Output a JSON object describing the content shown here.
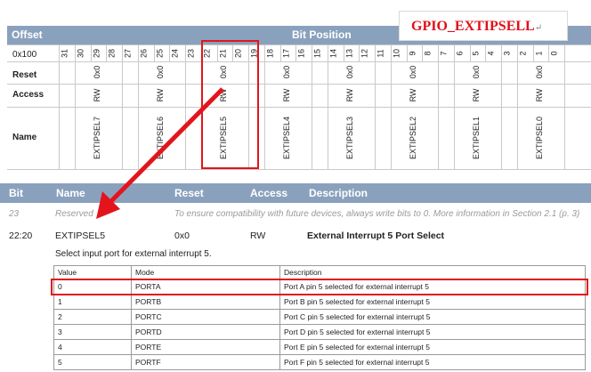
{
  "badge": {
    "title": "GPIO_EXTIPSELL",
    "mark": "↵"
  },
  "register": {
    "headers": {
      "offset": "Offset",
      "bit_position": "Bit Position"
    },
    "offset_value": "0x100",
    "row_labels": {
      "reset": "Reset",
      "access": "Access",
      "name": "Name"
    },
    "bits": [
      "31",
      "30",
      "29",
      "28",
      "27",
      "26",
      "25",
      "24",
      "23",
      "22",
      "21",
      "20",
      "19",
      "18",
      "17",
      "16",
      "15",
      "14",
      "13",
      "12",
      "11",
      "10",
      "9",
      "8",
      "7",
      "6",
      "5",
      "4",
      "3",
      "2",
      "1",
      "0"
    ],
    "fields": [
      {
        "name": "EXTIPSEL7",
        "reset": "0x0",
        "access": "RW"
      },
      {
        "name": "EXTIPSEL6",
        "reset": "0x0",
        "access": "RW"
      },
      {
        "name": "EXTIPSEL5",
        "reset": "0x0",
        "access": "RW"
      },
      {
        "name": "EXTIPSEL4",
        "reset": "0x0",
        "access": "RW"
      },
      {
        "name": "EXTIPSEL3",
        "reset": "0x0",
        "access": "RW"
      },
      {
        "name": "EXTIPSEL2",
        "reset": "0x0",
        "access": "RW"
      },
      {
        "name": "EXTIPSEL1",
        "reset": "0x0",
        "access": "RW"
      },
      {
        "name": "EXTIPSEL0",
        "reset": "0x0",
        "access": "RW"
      }
    ]
  },
  "fieldlist": {
    "headers": {
      "bit": "Bit",
      "name": "Name",
      "reset": "Reset",
      "access": "Access",
      "description": "Description"
    },
    "reserved": {
      "bit": "23",
      "name": "Reserved",
      "description": "To ensure compatibility with future devices, always write bits to 0. More information in Section 2.1 (p. 3)"
    },
    "field": {
      "bit": "22:20",
      "name": "EXTIPSEL5",
      "reset": "0x0",
      "access": "RW",
      "description": "External Interrupt 5 Port Select"
    },
    "sub_description": "Select input port for external interrupt 5."
  },
  "enum_table": {
    "headers": {
      "value": "Value",
      "mode": "Mode",
      "description": "Description"
    },
    "rows": [
      {
        "value": "0",
        "mode": "PORTA",
        "description": "Port A pin 5 selected for external interrupt 5"
      },
      {
        "value": "1",
        "mode": "PORTB",
        "description": "Port B pin 5 selected for external interrupt 5"
      },
      {
        "value": "2",
        "mode": "PORTC",
        "description": "Port C pin 5 selected for external interrupt 5"
      },
      {
        "value": "3",
        "mode": "PORTD",
        "description": "Port D pin 5 selected for external interrupt 5"
      },
      {
        "value": "4",
        "mode": "PORTE",
        "description": "Port E pin 5 selected for external interrupt 5"
      },
      {
        "value": "5",
        "mode": "PORTF",
        "description": "Port F pin 5 selected for external interrupt 5"
      }
    ]
  },
  "colors": {
    "header_bg": "#8aa1bd",
    "highlight": "#e3141c",
    "badge_text": "#e0101a"
  }
}
